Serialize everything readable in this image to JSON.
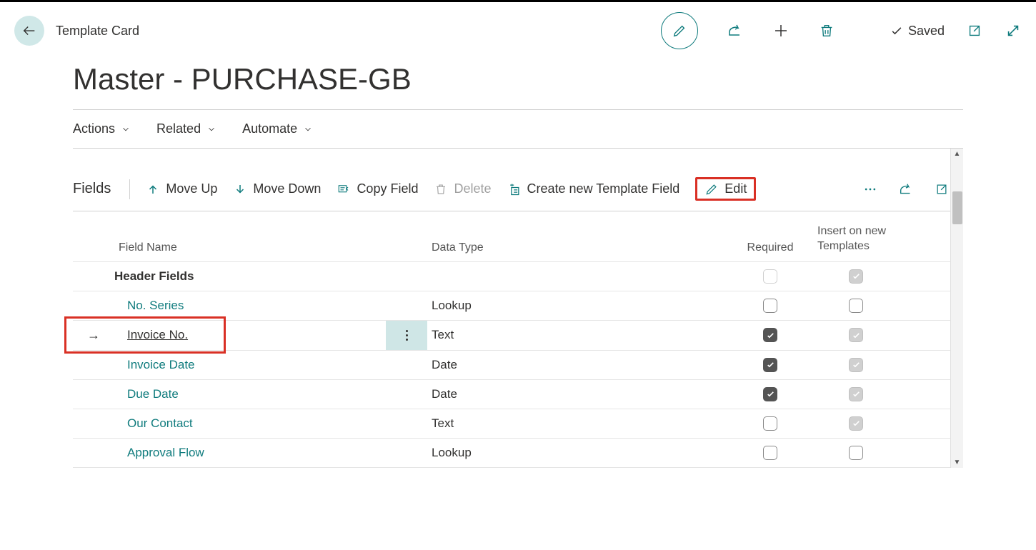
{
  "header": {
    "breadcrumb": "Template Card",
    "saved_label": "Saved"
  },
  "page_title": "Master - PURCHASE-GB",
  "menu": {
    "actions": "Actions",
    "related": "Related",
    "automate": "Automate"
  },
  "fields_toolbar": {
    "title": "Fields",
    "move_up": "Move Up",
    "move_down": "Move Down",
    "copy_field": "Copy Field",
    "delete": "Delete",
    "create_new": "Create new Template Field",
    "edit": "Edit"
  },
  "columns": {
    "field_name": "Field Name",
    "data_type": "Data Type",
    "required": "Required",
    "insert_on_new": "Insert on new Templates"
  },
  "rows": [
    {
      "group": true,
      "name": "Header Fields",
      "data_type": "",
      "required": false,
      "required_disabled": true,
      "insert": true,
      "insert_disabled": true
    },
    {
      "group": false,
      "name": "No. Series",
      "data_type": "Lookup",
      "required": false,
      "required_disabled": false,
      "insert": false,
      "insert_disabled": false,
      "selected": false
    },
    {
      "group": false,
      "name": "Invoice No.",
      "data_type": "Text",
      "required": true,
      "required_disabled": false,
      "insert": true,
      "insert_disabled": true,
      "selected": true
    },
    {
      "group": false,
      "name": "Invoice Date",
      "data_type": "Date",
      "required": true,
      "required_disabled": false,
      "insert": true,
      "insert_disabled": true
    },
    {
      "group": false,
      "name": "Due Date",
      "data_type": "Date",
      "required": true,
      "required_disabled": false,
      "insert": true,
      "insert_disabled": true
    },
    {
      "group": false,
      "name": "Our Contact",
      "data_type": "Text",
      "required": false,
      "required_disabled": false,
      "insert": true,
      "insert_disabled": true
    },
    {
      "group": false,
      "name": "Approval Flow",
      "data_type": "Lookup",
      "required": false,
      "required_disabled": false,
      "insert": false,
      "insert_disabled": false
    }
  ]
}
